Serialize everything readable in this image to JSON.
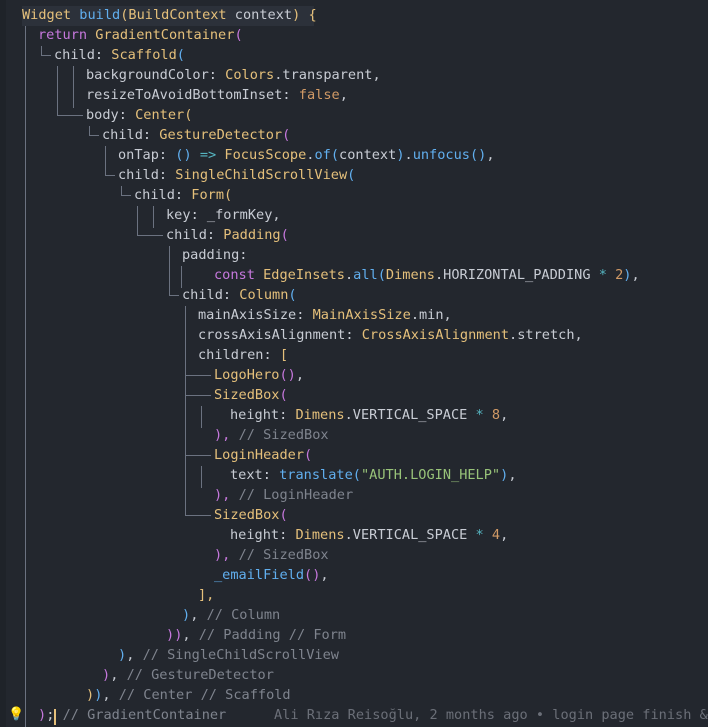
{
  "editor": {
    "lines": [
      {
        "segments": [
          [
            "t",
            "Widget"
          ],
          [
            "p",
            " "
          ],
          [
            "fm",
            "build"
          ],
          [
            "b1",
            "("
          ],
          [
            "t",
            "BuildContext"
          ],
          [
            "p",
            " context"
          ],
          [
            "b1",
            ")"
          ],
          [
            "p",
            " "
          ],
          [
            "b1",
            "{"
          ]
        ]
      },
      {
        "segments": [
          [
            "k",
            "return"
          ],
          [
            "p",
            " "
          ],
          [
            "t",
            "GradientContainer"
          ],
          [
            "b2",
            "("
          ]
        ]
      },
      {
        "segments": [
          [
            "pr",
            "child"
          ],
          [
            "p",
            ": "
          ],
          [
            "t",
            "Scaffold"
          ],
          [
            "b3",
            "("
          ]
        ]
      },
      {
        "segments": [
          [
            "pr",
            "backgroundColor"
          ],
          [
            "p",
            ": "
          ],
          [
            "t",
            "Colors"
          ],
          [
            "p",
            ".transparent,"
          ]
        ]
      },
      {
        "segments": [
          [
            "pr",
            "resizeToAvoidBottomInset"
          ],
          [
            "p",
            ": "
          ],
          [
            "n",
            "false"
          ],
          [
            "p",
            ","
          ]
        ]
      },
      {
        "segments": [
          [
            "pr",
            "body"
          ],
          [
            "p",
            ": "
          ],
          [
            "t",
            "Center"
          ],
          [
            "b1",
            "("
          ]
        ]
      },
      {
        "segments": [
          [
            "pr",
            "child"
          ],
          [
            "p",
            ": "
          ],
          [
            "t",
            "GestureDetector"
          ],
          [
            "b2",
            "("
          ]
        ]
      },
      {
        "segments": [
          [
            "pr",
            "onTap"
          ],
          [
            "p",
            ": "
          ],
          [
            "b3",
            "()"
          ],
          [
            "p",
            " "
          ],
          [
            "o",
            "=>"
          ],
          [
            "p",
            " "
          ],
          [
            "t",
            "FocusScope"
          ],
          [
            "p",
            "."
          ],
          [
            "fm",
            "of"
          ],
          [
            "b3",
            "("
          ],
          [
            "p",
            "context"
          ],
          [
            "b3",
            ")"
          ],
          [
            "p",
            "."
          ],
          [
            "fm",
            "unfocus"
          ],
          [
            "b3",
            "()"
          ],
          [
            "p",
            ","
          ]
        ]
      },
      {
        "segments": [
          [
            "pr",
            "child"
          ],
          [
            "p",
            ": "
          ],
          [
            "t",
            "SingleChildScrollView"
          ],
          [
            "b3",
            "("
          ]
        ]
      },
      {
        "segments": [
          [
            "pr",
            "child"
          ],
          [
            "p",
            ": "
          ],
          [
            "t",
            "Form"
          ],
          [
            "b1",
            "("
          ]
        ]
      },
      {
        "segments": [
          [
            "pr",
            "key"
          ],
          [
            "p",
            ": _formKey,"
          ]
        ]
      },
      {
        "segments": [
          [
            "pr",
            "child"
          ],
          [
            "p",
            ": "
          ],
          [
            "t",
            "Padding"
          ],
          [
            "b2",
            "("
          ]
        ]
      },
      {
        "segments": [
          [
            "pr",
            "padding"
          ],
          [
            "p",
            ":"
          ]
        ]
      },
      {
        "segments": [
          [
            "k",
            "const"
          ],
          [
            "p",
            " "
          ],
          [
            "t",
            "EdgeInsets"
          ],
          [
            "p",
            "."
          ],
          [
            "fm",
            "all"
          ],
          [
            "b3",
            "("
          ],
          [
            "t",
            "Dimens"
          ],
          [
            "p",
            ".HORIZONTAL_PADDING "
          ],
          [
            "o",
            "*"
          ],
          [
            "p",
            " "
          ],
          [
            "n",
            "2"
          ],
          [
            "b3",
            ")"
          ],
          [
            "p",
            ","
          ]
        ]
      },
      {
        "segments": [
          [
            "pr",
            "child"
          ],
          [
            "p",
            ": "
          ],
          [
            "t",
            "Column"
          ],
          [
            "b3",
            "("
          ]
        ]
      },
      {
        "segments": [
          [
            "pr",
            "mainAxisSize"
          ],
          [
            "p",
            ": "
          ],
          [
            "t",
            "MainAxisSize"
          ],
          [
            "p",
            ".min,"
          ]
        ]
      },
      {
        "segments": [
          [
            "pr",
            "crossAxisAlignment"
          ],
          [
            "p",
            ": "
          ],
          [
            "t",
            "CrossAxisAlignment"
          ],
          [
            "p",
            ".stretch,"
          ]
        ]
      },
      {
        "segments": [
          [
            "pr",
            "children"
          ],
          [
            "p",
            ": "
          ],
          [
            "b1",
            "["
          ]
        ]
      },
      {
        "segments": [
          [
            "t",
            "LogoHero"
          ],
          [
            "b2",
            "()"
          ],
          [
            "p",
            ","
          ]
        ]
      },
      {
        "segments": [
          [
            "t",
            "SizedBox"
          ],
          [
            "b2",
            "("
          ]
        ]
      },
      {
        "segments": [
          [
            "pr",
            "height"
          ],
          [
            "p",
            ": "
          ],
          [
            "t",
            "Dimens"
          ],
          [
            "p",
            ".VERTICAL_SPACE "
          ],
          [
            "o",
            "*"
          ],
          [
            "p",
            " "
          ],
          [
            "n",
            "8"
          ],
          [
            "p",
            ","
          ]
        ]
      },
      {
        "segments": [
          [
            "b2",
            "),"
          ],
          [
            "p",
            " "
          ],
          [
            "c",
            "// SizedBox"
          ]
        ]
      },
      {
        "segments": [
          [
            "t",
            "LoginHeader"
          ],
          [
            "b2",
            "("
          ]
        ]
      },
      {
        "segments": [
          [
            "pr",
            "text"
          ],
          [
            "p",
            ": "
          ],
          [
            "fm",
            "translate"
          ],
          [
            "b3",
            "("
          ],
          [
            "s",
            "\"AUTH.LOGIN_HELP\""
          ],
          [
            "b3",
            ")"
          ],
          [
            "p",
            ","
          ]
        ]
      },
      {
        "segments": [
          [
            "b2",
            "),"
          ],
          [
            "p",
            " "
          ],
          [
            "c",
            "// LoginHeader"
          ]
        ]
      },
      {
        "segments": [
          [
            "t",
            "SizedBox"
          ],
          [
            "b2",
            "("
          ]
        ]
      },
      {
        "segments": [
          [
            "pr",
            "height"
          ],
          [
            "p",
            ": "
          ],
          [
            "t",
            "Dimens"
          ],
          [
            "p",
            ".VERTICAL_SPACE "
          ],
          [
            "o",
            "*"
          ],
          [
            "p",
            " "
          ],
          [
            "n",
            "4"
          ],
          [
            "p",
            ","
          ]
        ]
      },
      {
        "segments": [
          [
            "b2",
            "),"
          ],
          [
            "p",
            " "
          ],
          [
            "c",
            "// SizedBox"
          ]
        ]
      },
      {
        "segments": [
          [
            "fm",
            "_emailField"
          ],
          [
            "b2",
            "()"
          ],
          [
            "p",
            ","
          ]
        ]
      },
      {
        "segments": [
          [
            "b1",
            "],"
          ]
        ]
      },
      {
        "segments": [
          [
            "b3",
            ")"
          ],
          [
            "p",
            ", "
          ],
          [
            "c",
            "// Column"
          ]
        ]
      },
      {
        "segments": [
          [
            "b2",
            ")"
          ],
          [
            "b2",
            ")"
          ],
          [
            "p",
            ", "
          ],
          [
            "c",
            "// Padding // Form"
          ]
        ]
      },
      {
        "segments": [
          [
            "b3",
            ")"
          ],
          [
            "p",
            ", "
          ],
          [
            "c",
            "// SingleChildScrollView"
          ]
        ]
      },
      {
        "segments": [
          [
            "b2",
            ")"
          ],
          [
            "p",
            ", "
          ],
          [
            "c",
            "// GestureDetector"
          ]
        ]
      },
      {
        "segments": [
          [
            "b1",
            ")"
          ],
          [
            "b3",
            ")"
          ],
          [
            "p",
            ", "
          ],
          [
            "c",
            "// Center // Scaffold"
          ]
        ]
      },
      {
        "segments": [
          [
            "b2",
            ")"
          ],
          [
            "p",
            "; "
          ],
          [
            "c",
            "// GradientContainer"
          ]
        ]
      }
    ],
    "blame": "Ali Rıza Reisoğlu, 2 months ago • login page finish &",
    "lightbulb_icon": "lightbulb-icon",
    "colors": {
      "background": "#23272e",
      "keyword": "#c678dd",
      "type": "#e5c07b",
      "method": "#61afef",
      "string": "#98c379",
      "number": "#d19a66",
      "comment": "#7f848e"
    }
  }
}
